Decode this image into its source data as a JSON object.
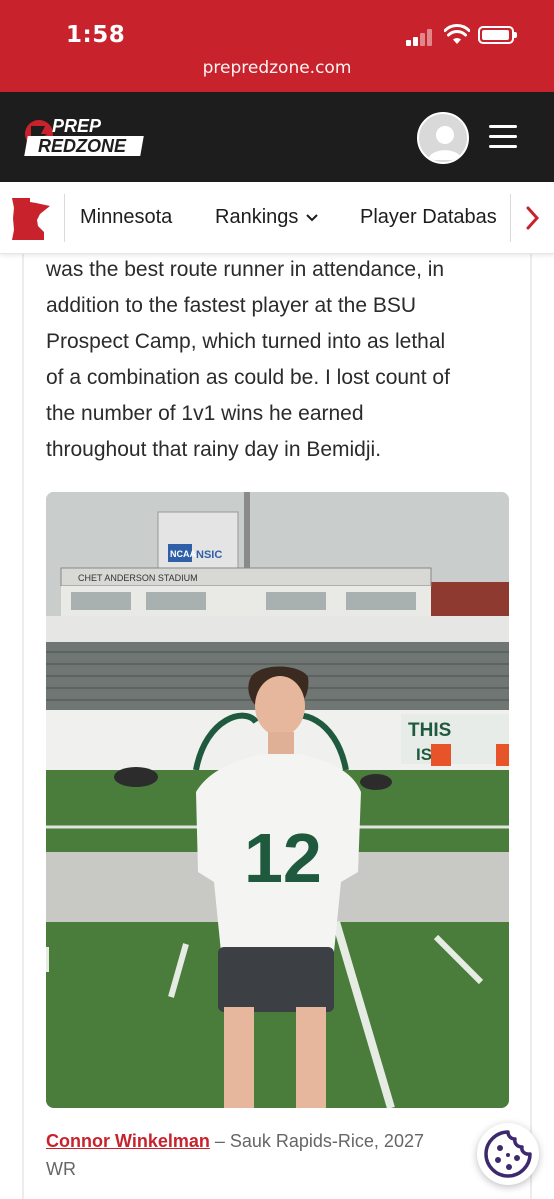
{
  "status_bar": {
    "time": "1:58",
    "url": "prepredzone.com"
  },
  "header": {
    "logo_text": "PREP REDZONE"
  },
  "nav": {
    "items": [
      {
        "label": "Minnesota"
      },
      {
        "label": "Rankings"
      },
      {
        "label": "Player Databas"
      }
    ]
  },
  "article": {
    "paragraph_lines": [
      "was the best route runner in attendance, in",
      "addition to the fastest player at the BSU",
      "Prospect Camp, which turned into as lethal",
      "of a combination as could be. I lost count of",
      "the number of 1v1 wins he earned",
      "throughout that rainy day in Bemidji."
    ],
    "photo": {
      "jersey_number": "12",
      "stadium_sign": "CHET ANDERSON STADIUM",
      "banner_left": "NCAA",
      "banner_right": "NSIC",
      "wall_text_1": "THIS",
      "wall_text_2": "IS"
    },
    "caption": {
      "name": "Connor Winkelman",
      "details": " – Sauk Rapids-Rice, 2027",
      "position": "WR"
    }
  },
  "colors": {
    "brand_red": "#c8232c",
    "header_dark": "#1d1d1d",
    "cookie_purple": "#3d2a6e"
  }
}
